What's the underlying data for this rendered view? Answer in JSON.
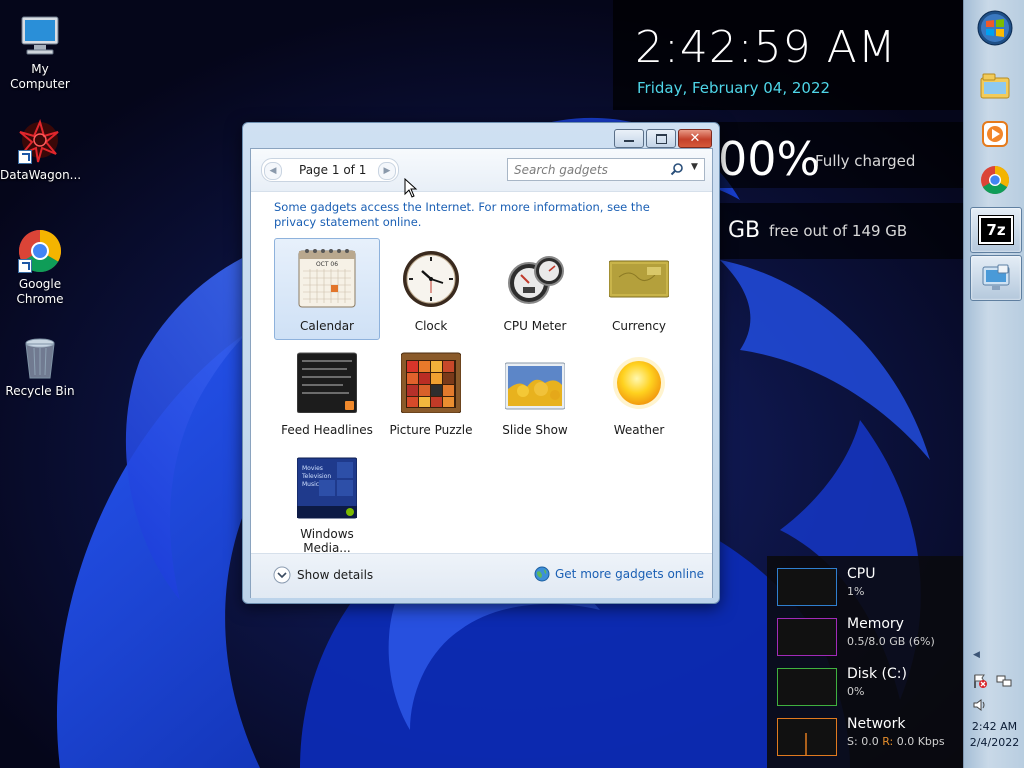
{
  "desktop": {
    "icons": [
      {
        "label": "My Computer"
      },
      {
        "label": "DataWagon..."
      },
      {
        "label": "Google Chrome"
      },
      {
        "label": "Recycle Bin"
      }
    ]
  },
  "clock": {
    "time": "2:42:59 AM",
    "date": "Friday, February 04, 2022"
  },
  "battery": {
    "percent": "00%",
    "status": "Fully charged"
  },
  "disk_gadget": {
    "value": "GB",
    "free": "free out of 149 GB"
  },
  "resources": [
    {
      "name": "CPU",
      "value": "1%",
      "color": "#2f7fcf"
    },
    {
      "name": "Memory",
      "value": "0.5/8.0 GB (6%)",
      "color": "#a22ab8"
    },
    {
      "name": "Disk (C:)",
      "value": "0%",
      "color": "#3fb13f"
    },
    {
      "name": "Network",
      "value_s_label": "S:",
      "value_s": "0.0",
      "value_r_label": "R:",
      "value_r": "0.0 Kbps",
      "color": "#e07a1f"
    }
  ],
  "gadget_window": {
    "page_label": "Page 1 of 1",
    "search_placeholder": "Search gadgets",
    "info_text": "Some gadgets access the Internet.  For more information, see the privacy statement online.",
    "gadgets": [
      {
        "label": "Calendar",
        "selected": true,
        "icon": "calendar-icon"
      },
      {
        "label": "Clock",
        "icon": "clock-icon"
      },
      {
        "label": "CPU Meter",
        "icon": "cpu-meter-icon"
      },
      {
        "label": "Currency",
        "icon": "currency-icon"
      },
      {
        "label": "Feed Headlines",
        "icon": "feed-headlines-icon"
      },
      {
        "label": "Picture Puzzle",
        "icon": "picture-puzzle-icon"
      },
      {
        "label": "Slide Show",
        "icon": "slide-show-icon"
      },
      {
        "label": "Weather",
        "icon": "weather-icon"
      },
      {
        "label": "Windows Media...",
        "icon": "windows-media-icon"
      }
    ],
    "calendar_month": "OCT 06",
    "media_menu": [
      "Movies",
      "Television",
      "Music"
    ],
    "show_details": "Show details",
    "get_more": "Get more gadgets online"
  },
  "taskbar": {
    "tray_time": "2:42 AM",
    "tray_date": "2/4/2022",
    "seven_zip_label": "7z"
  },
  "colors": {
    "accent_link": "#1a5fb4",
    "clock_date": "#4fd6e8"
  }
}
